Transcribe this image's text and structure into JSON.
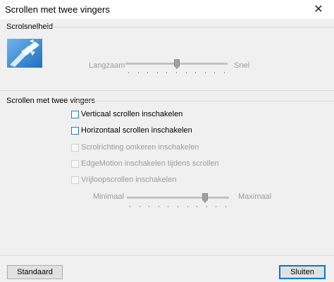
{
  "window": {
    "title": "Scrollen met twee vingers",
    "close_icon": "close-icon"
  },
  "speed_section": {
    "title": "Scrolsnelheid",
    "illustration_icon": "touchpad-scroll-illustration",
    "slider": {
      "min_label": "Langzaam",
      "max_label": "Snel",
      "value_fraction": 0.5,
      "enabled": false
    }
  },
  "two_finger_section": {
    "title": "Scrollen met twee vingers",
    "options": [
      {
        "label": "Verticaal scrollen inschakelen",
        "checked": false,
        "enabled": true
      },
      {
        "label": "Horizontaal scrollen inschakelen",
        "checked": false,
        "enabled": true
      },
      {
        "label": "Scrolrichting omkeren inschakelen",
        "checked": false,
        "enabled": false
      },
      {
        "label": "EdgeMotion inschakelen tijdens scrollen",
        "checked": false,
        "enabled": false
      },
      {
        "label": "Vrijloopscrollen inschakelen",
        "checked": false,
        "enabled": false
      }
    ],
    "slider": {
      "min_label": "Minimaal",
      "max_label": "Maximaal",
      "value_fraction": 0.78,
      "enabled": false
    }
  },
  "footer": {
    "default_button": "Standaard",
    "close_button": "Sluiten"
  },
  "colors": {
    "accent": "#0078d7",
    "disabled_text": "#9c9c9c"
  }
}
